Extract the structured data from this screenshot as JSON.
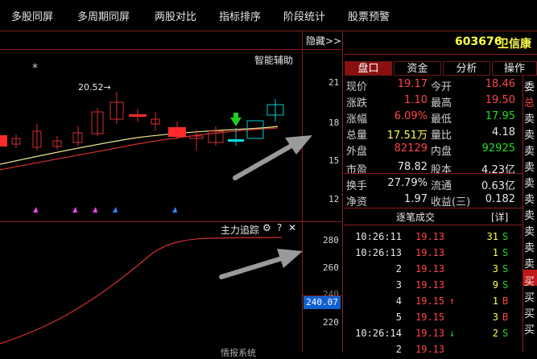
{
  "menu": [
    "多股同屏",
    "多周期同屏",
    "两股对比",
    "指标排序",
    "阶段统计",
    "股票预警"
  ],
  "chart": {
    "hide_label": "隐藏>>",
    "indicator_main": "智能辅助",
    "price_label": "20.52→",
    "star": "*",
    "y_main": [
      "21",
      "18",
      "15",
      "12"
    ],
    "indicator_sub": "主力追踪",
    "sub_icons": [
      "⚙",
      "?",
      "✕"
    ],
    "y_sub": [
      "280",
      "260",
      "240",
      "220"
    ],
    "current_sub_value": "240.07",
    "bottom_cut_label": "情报系统"
  },
  "stock": {
    "code": "603676",
    "name": "卫信康"
  },
  "tabs": [
    "盘口",
    "资金",
    "分析",
    "操作"
  ],
  "quote_rows": [
    {
      "l1": "现价",
      "v1": "19.17",
      "c1": "red",
      "l2": "今开",
      "v2": "18.46",
      "c2": "red"
    },
    {
      "l1": "涨跌",
      "v1": "1.10",
      "c1": "red",
      "l2": "最高",
      "v2": "19.50",
      "c2": "red"
    },
    {
      "l1": "涨幅",
      "v1": "6.09%",
      "c1": "red",
      "l2": "最低",
      "v2": "17.95",
      "c2": "green"
    },
    {
      "l1": "总量",
      "v1": "17.51万",
      "c1": "yellow",
      "l2": "量比",
      "v2": "4.18",
      "c2": "white"
    },
    {
      "l1": "外盘",
      "v1": "82129",
      "c1": "red",
      "l2": "内盘",
      "v2": "92925",
      "c2": "green"
    },
    {
      "l1": "市盈",
      "v1": "78.82",
      "c1": "white",
      "l2": "股本",
      "v2": "4.23亿",
      "c2": "white"
    },
    {
      "l1": "换手",
      "v1": "27.79%",
      "c1": "white",
      "l2": "流通",
      "v2": "0.63亿",
      "c2": "white"
    },
    {
      "l1": "净资",
      "v1": "1.97",
      "c1": "white",
      "l2": "收益(三)",
      "v2": "0.182",
      "c2": "white"
    }
  ],
  "trades_title": "逐笔成交",
  "trades_detail": "[详]",
  "trades": [
    {
      "time": "10:26:11",
      "price": "19.13",
      "arrow": "",
      "vol": "31",
      "side": "S"
    },
    {
      "time": "10:26:13",
      "price": "19.13",
      "arrow": "",
      "vol": "1",
      "side": "S"
    },
    {
      "time": "2",
      "price": "19.13",
      "arrow": "",
      "vol": "3",
      "side": "S"
    },
    {
      "time": "3",
      "price": "19.13",
      "arrow": "",
      "vol": "9",
      "side": "S"
    },
    {
      "time": "4",
      "price": "19.15",
      "arrow": "↑",
      "vol": "1",
      "side": "B"
    },
    {
      "time": "5",
      "price": "19.15",
      "arrow": "",
      "vol": "3",
      "side": "B"
    },
    {
      "time": "10:26:14",
      "price": "19.13",
      "arrow": "↓",
      "vol": "2",
      "side": "S"
    },
    {
      "time": "2",
      "price": "19.13",
      "arrow": "",
      "vol": "",
      "side": ""
    }
  ],
  "side_chars": [
    "委",
    "总",
    "卖",
    "卖",
    "卖",
    "卖",
    "卖",
    "卖",
    "卖",
    "卖",
    "卖",
    "卖",
    "买",
    "买",
    "买",
    "买"
  ],
  "colors": {
    "up": "#ff4444",
    "down": "#22dd22",
    "grid": "#8a1e1e",
    "tab_active": "#8a1010"
  }
}
